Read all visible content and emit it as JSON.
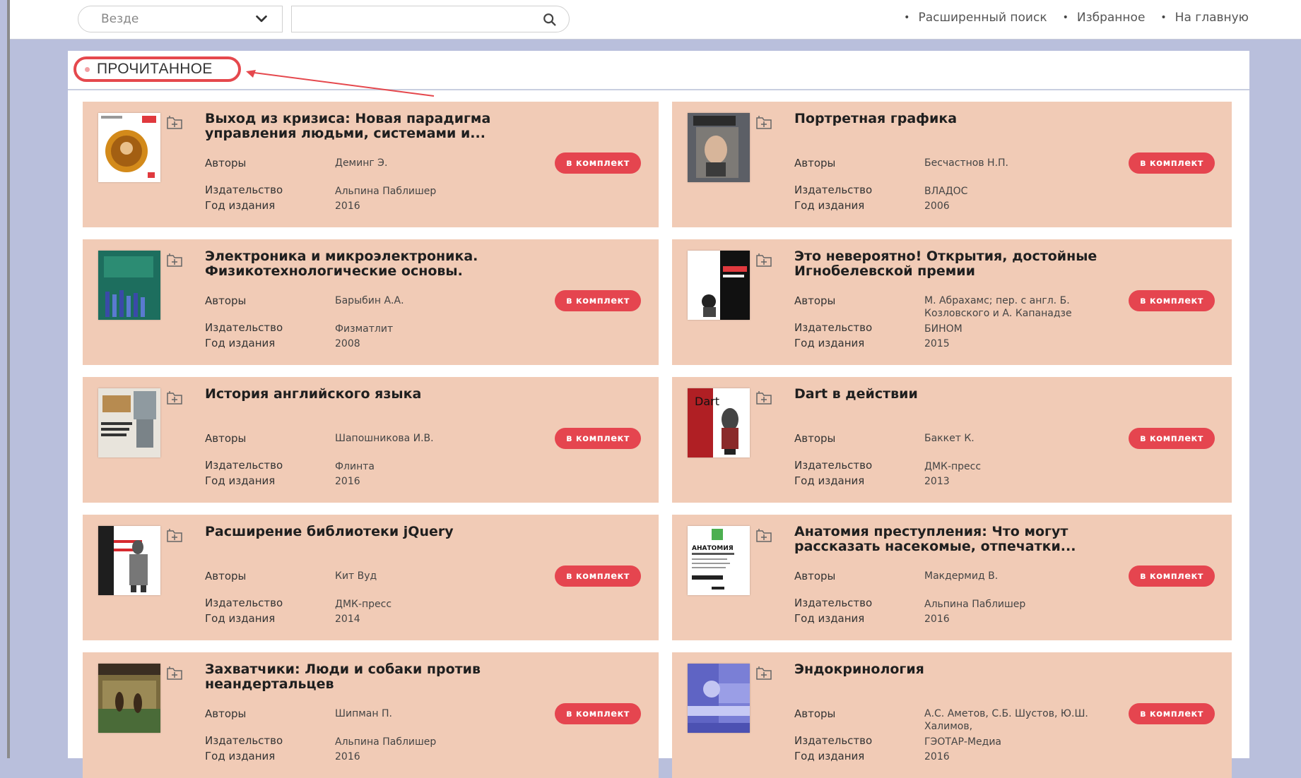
{
  "search": {
    "scope": "Везде",
    "query": "",
    "placeholder": ""
  },
  "top_links": [
    "Расширенный поиск",
    "Избранное",
    "На главную"
  ],
  "section": {
    "title": "ПРОЧИТАННОЕ"
  },
  "labels": {
    "authors": "Авторы",
    "publisher": "Издательство",
    "year": "Год издания"
  },
  "button_label": "в комплект",
  "books": [
    {
      "title": "Выход из кризиса: Новая парадигма управления людьми, системами и...",
      "authors": "Деминг Э.",
      "publisher": "Альпина Паблишер",
      "year": "2016",
      "cover": "orange-medallion"
    },
    {
      "title": "Портретная графика",
      "authors": "Бесчастнов Н.П.",
      "publisher": "ВЛАДОС",
      "year": "2006",
      "cover": "portrait"
    },
    {
      "title": "Электроника и микроэлектроника. Физикотехнологические основы.",
      "authors": "Барыбин А.А.",
      "publisher": "Физматлит",
      "year": "2008",
      "cover": "green-circuit"
    },
    {
      "title": "Это невероятно! Открытия, достойные Игнобелевской премии",
      "authors": "М. Абрахамс; пер. с англ. Б. Козловского и А. Капанадзе",
      "publisher": "БИНОМ",
      "year": "2015",
      "cover": "black-white"
    },
    {
      "title": "История английского языка",
      "authors": "Шапошникова И.В.",
      "publisher": "Флинта",
      "year": "2016",
      "cover": "castle"
    },
    {
      "title": "Dart в действии",
      "authors": "Баккет К.",
      "publisher": "ДМК-пресс",
      "year": "2013",
      "cover": "dart"
    },
    {
      "title": "Расширение библиотеки jQuery",
      "authors": "Кит Вуд",
      "publisher": "ДМК-пресс",
      "year": "2014",
      "cover": "jquery"
    },
    {
      "title": "Анатомия преступления: Что могут рассказать насекомые, отпечатки...",
      "authors": "Макдермид В.",
      "publisher": "Альпина Паблишер",
      "year": "2016",
      "cover": "anatomy"
    },
    {
      "title": "Захватчики: Люди и собаки против неандертальцев",
      "authors": "Шипман П.",
      "publisher": "Альпина Паблишер",
      "year": "2016",
      "cover": "invaders"
    },
    {
      "title": "Эндокринология",
      "authors": "А.С. Аметов, С.Б. Шустов, Ю.Ш. Халимов,",
      "publisher": "ГЭОТАР-Медиа",
      "year": "2016",
      "cover": "endocrinology"
    }
  ],
  "colors": {
    "card_bg": "#f1cbb6",
    "button": "#e5454f",
    "page_bg": "#b9bfdc",
    "highlight": "#e5484d"
  }
}
